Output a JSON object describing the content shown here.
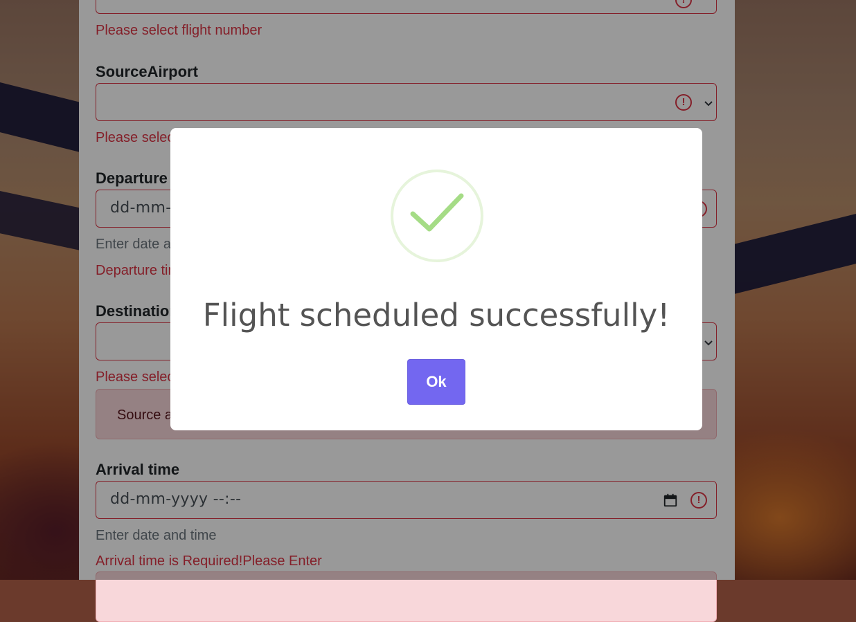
{
  "form": {
    "flight_number_error": "Please select flight number",
    "source_airport": {
      "label": "SourceAirport",
      "error": "Please select source airport"
    },
    "departure_time": {
      "label": "Departure time",
      "placeholder": "dd-mm-yyyy --:--",
      "help": "Enter date and time",
      "error": "Departure time is Required!Please Enter"
    },
    "destination_airport": {
      "label": "Destination Airport",
      "error": "Please select destination airport"
    },
    "airport_alert": "Source and destination airport cannot be same",
    "arrival_time": {
      "label": "Arrival time",
      "placeholder": "dd-mm-yyyy --:--",
      "help": "Enter date and time",
      "error": "Arrival time is Required!Please Enter"
    }
  },
  "modal": {
    "title": "Flight scheduled successfully!",
    "ok_label": "Ok",
    "icon": "success-check-icon"
  },
  "colors": {
    "error": "#dc3545",
    "confirm_button": "#7367f0",
    "success_check": "#a5dc86"
  }
}
